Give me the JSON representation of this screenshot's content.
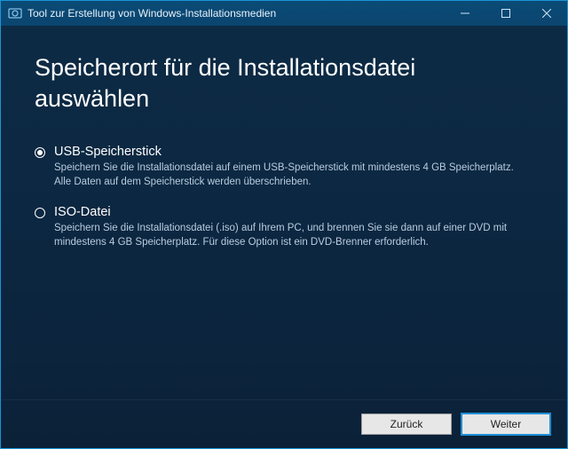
{
  "colors": {
    "titlebar": "#0a4b76",
    "body_top": "#0d2b45",
    "body_bottom": "#0b2138",
    "accent": "#1e90d6"
  },
  "titlebar": {
    "app_icon_name": "media-creation-icon",
    "title": "Tool zur Erstellung von Windows-Installationsmedien",
    "minimize_name": "minimize-icon",
    "maximize_name": "maximize-icon",
    "close_name": "close-icon"
  },
  "main": {
    "heading": "Speicherort für die Installationsdatei auswählen",
    "options": [
      {
        "id": "usb",
        "selected": true,
        "title": "USB-Speicherstick",
        "desc": "Speichern Sie die Installationsdatei auf einem USB-Speicherstick mit mindestens 4 GB Speicherplatz. Alle Daten auf dem Speicherstick werden überschrieben."
      },
      {
        "id": "iso",
        "selected": false,
        "title": "ISO-Datei",
        "desc": "Speichern Sie die Installationsdatei (.iso) auf Ihrem PC, und brennen Sie sie dann auf einer DVD mit mindestens 4 GB Speicherplatz. Für diese Option ist ein DVD-Brenner erforderlich."
      }
    ]
  },
  "footer": {
    "back_label": "Zurück",
    "next_label": "Weiter"
  }
}
